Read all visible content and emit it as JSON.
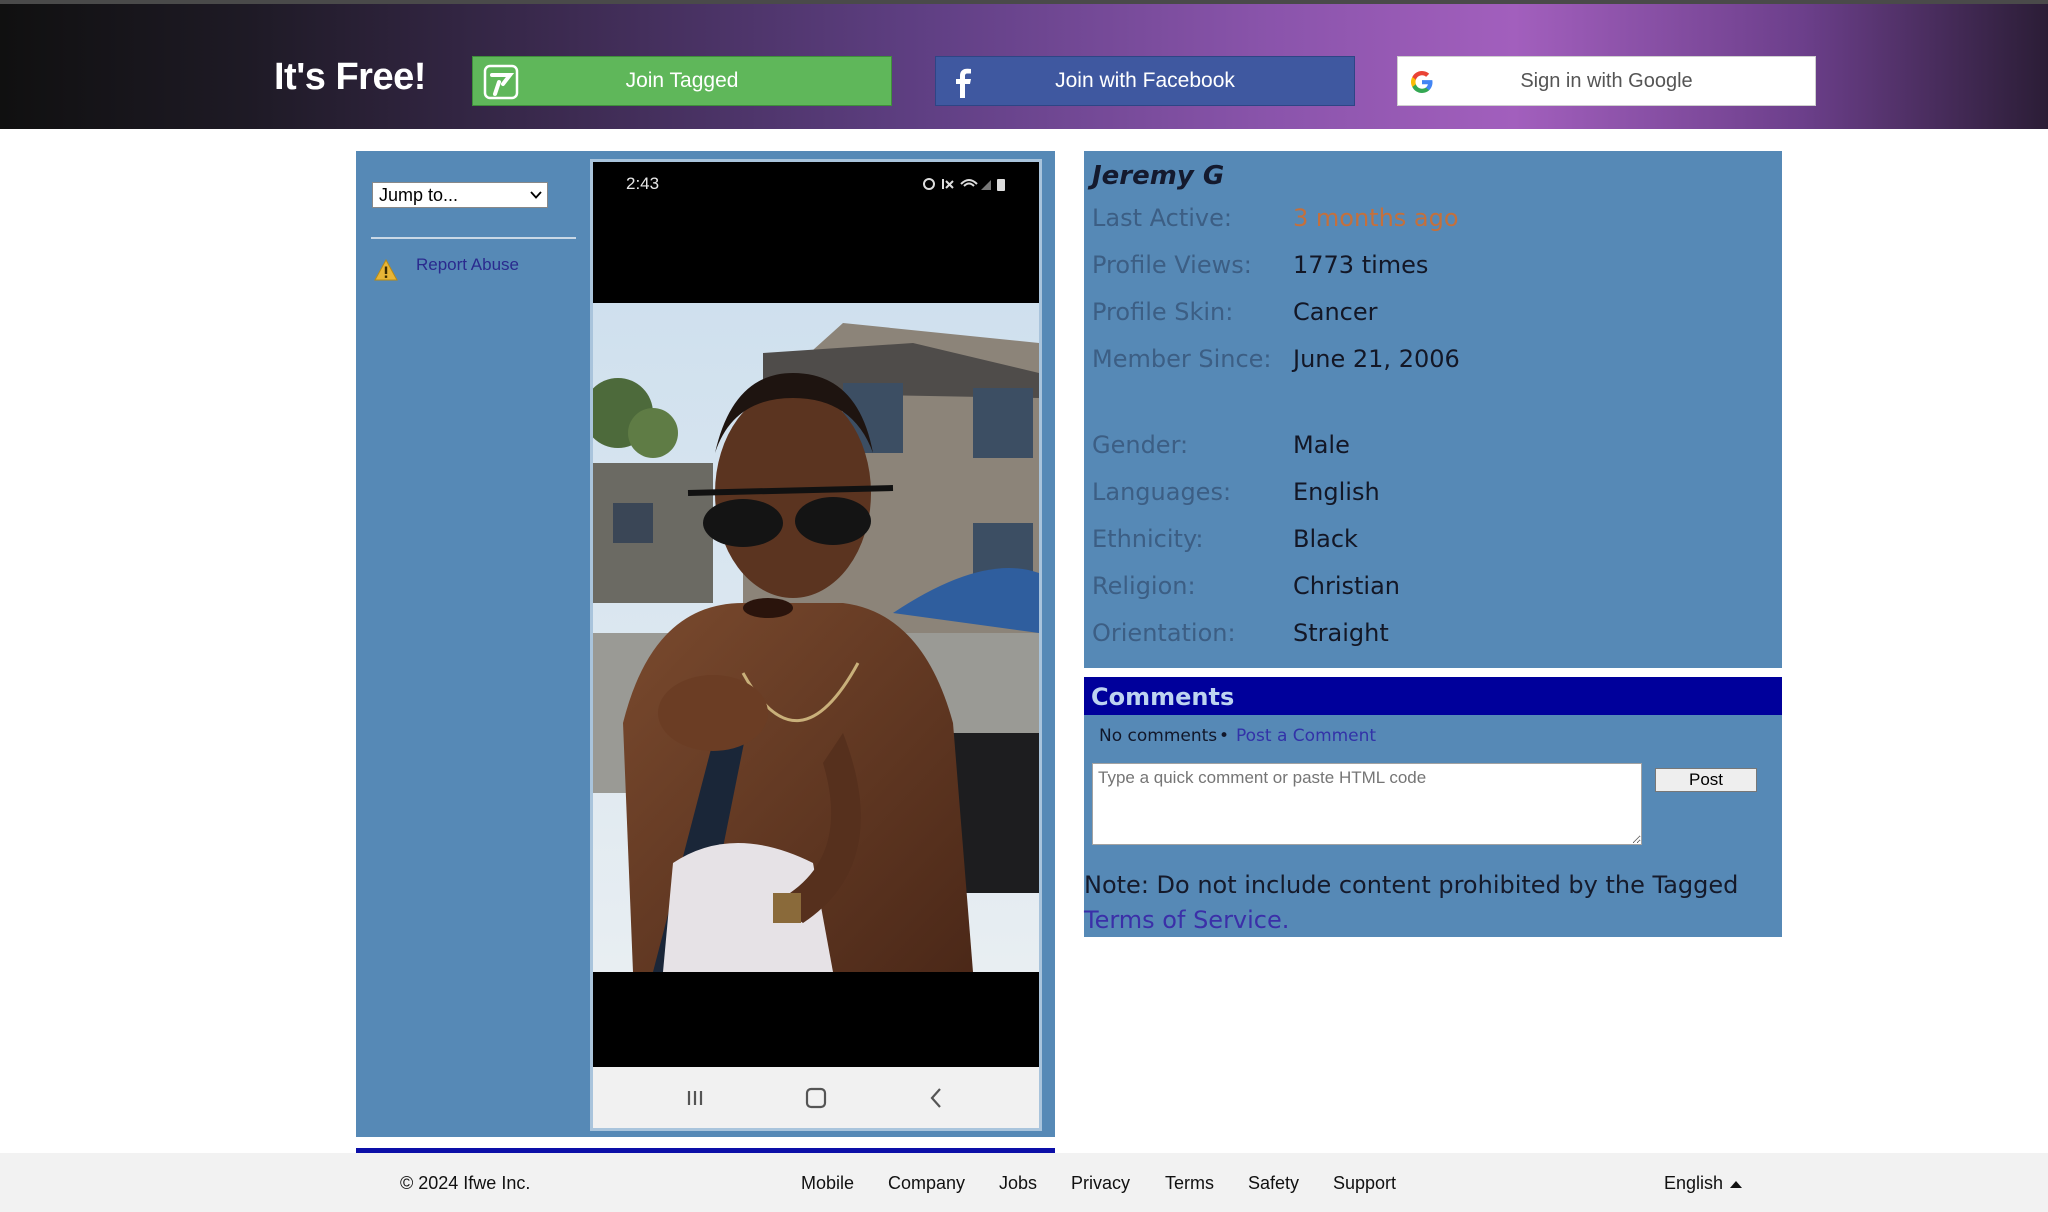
{
  "header": {
    "tagline": "It's Free!",
    "join_tagged": "Join Tagged",
    "join_facebook": "Join with Facebook",
    "sign_in_google": "Sign in with Google",
    "icons": [
      "tagged-logo-icon",
      "facebook-icon",
      "google-icon"
    ]
  },
  "sidebar": {
    "jump_to": "Jump to...",
    "report_abuse": "Report Abuse"
  },
  "photo": {
    "status_time": "2:43"
  },
  "profile": {
    "name": "Jeremy G",
    "fields": [
      {
        "label": "Last Active:",
        "value": "3 months ago"
      },
      {
        "label": "Profile Views:",
        "value": "1773 times"
      },
      {
        "label": "Profile Skin:",
        "value": "Cancer"
      },
      {
        "label": "Member Since:",
        "value": "June 21, 2006"
      },
      {
        "label": "Gender:",
        "value": "Male"
      },
      {
        "label": "Languages:",
        "value": "English"
      },
      {
        "label": "Ethnicity:",
        "value": "Black"
      },
      {
        "label": "Religion:",
        "value": "Christian"
      },
      {
        "label": "Orientation:",
        "value": "Straight"
      }
    ]
  },
  "comments": {
    "title": "Comments",
    "no_comments": "No comments",
    "bullet": "•",
    "post_a_comment": "Post a Comment",
    "placeholder": "Type a quick comment or paste HTML code",
    "post_button": "Post",
    "note_text": "Note: Do not include content prohibited by the Tagged",
    "terms_link": "Terms of Service."
  },
  "footer": {
    "copyright": "© 2024 Ifwe Inc.",
    "links": [
      "Mobile",
      "Company",
      "Jobs",
      "Privacy",
      "Terms",
      "Safety",
      "Support"
    ],
    "language": "English"
  },
  "colors": {
    "panel_blue": "#5689b6",
    "comments_header": "#00009b",
    "join_green": "#5fb75a",
    "facebook_blue": "#3f58a0",
    "last_active_orange": "#c4703c"
  }
}
